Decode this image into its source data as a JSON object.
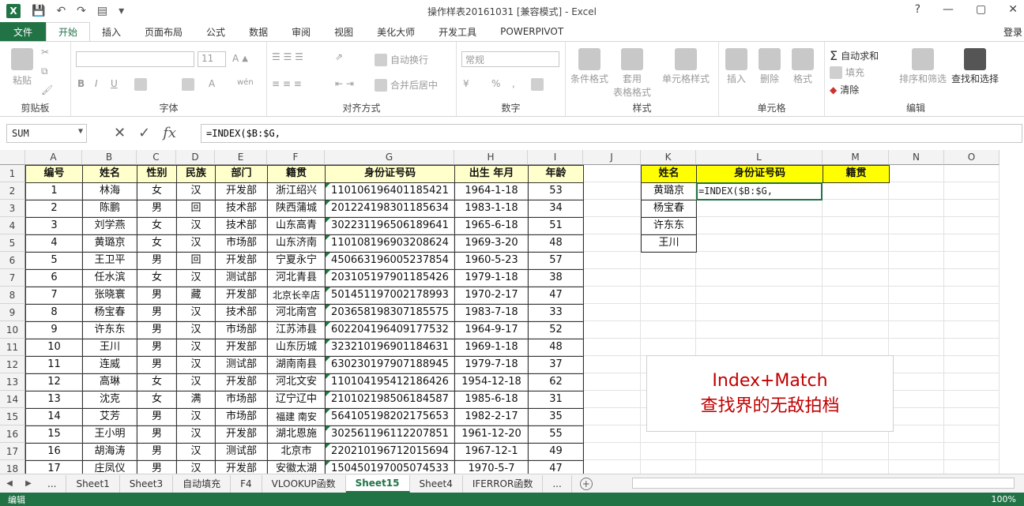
{
  "app": {
    "title": "操作样表20161031 [兼容模式] - Excel",
    "logo": "X"
  },
  "qat": {
    "save": "save-icon",
    "undo": "undo-icon",
    "redo": "redo-icon"
  },
  "window": {
    "help": "?",
    "minimize": "—",
    "restore": "▢",
    "close": "✕"
  },
  "tabs": [
    "开始",
    "插入",
    "页面布局",
    "公式",
    "数据",
    "审阅",
    "视图",
    "美化大师",
    "开发工具",
    "POWERPIVOT"
  ],
  "file_tab": "文件",
  "login": "登录",
  "ribbon": {
    "clipboard": {
      "paste": "粘贴",
      "label": "剪贴板"
    },
    "font": {
      "size": "11",
      "label": "字体",
      "bold": "B",
      "italic": "I",
      "underline": "U",
      "wen": "wén"
    },
    "alignment": {
      "wrap": "自动换行",
      "merge": "合并后居中",
      "label": "对齐方式"
    },
    "number": {
      "format": "常规",
      "pct": "%",
      "comma": ",",
      "label": "数字"
    },
    "styles": {
      "cond": "条件格式",
      "table1": "套用",
      "table2": "表格格式",
      "cell": "单元格样式",
      "label": "样式"
    },
    "cells": {
      "insert": "插入",
      "delete": "删除",
      "format": "格式",
      "label": "单元格"
    },
    "editing": {
      "autosum": "自动求和",
      "fill": "填充",
      "clear": "清除",
      "sort": "排序和筛选",
      "find": "查找和选择",
      "label": "编辑"
    }
  },
  "formula_bar": {
    "name_box": "SUM",
    "cancel": "✕",
    "enter": "✓",
    "fx": "fx",
    "formula": "=INDEX($B:$G,"
  },
  "columns": [
    "A",
    "B",
    "C",
    "D",
    "E",
    "F",
    "G",
    "H",
    "I",
    "J",
    "K",
    "L",
    "M",
    "N",
    "O"
  ],
  "rows": [
    "1",
    "2",
    "3",
    "4",
    "5",
    "6",
    "7",
    "8",
    "9",
    "10",
    "11",
    "12",
    "13",
    "14",
    "15",
    "16",
    "17",
    "18"
  ],
  "table": {
    "headers": [
      "编号",
      "姓名",
      "性别",
      "民族",
      "部门",
      "籍贯",
      "身份证号码",
      "出生 年月",
      "年龄"
    ],
    "data": [
      [
        "1",
        "林海",
        "女",
        "汉",
        "开发部",
        "浙江绍兴",
        "110106196401185421",
        "1964-1-18",
        "53"
      ],
      [
        "2",
        "陈鹏",
        "男",
        "回",
        "技术部",
        "陕西蒲城",
        "201224198301185634",
        "1983-1-18",
        "34"
      ],
      [
        "3",
        "刘学燕",
        "女",
        "汉",
        "技术部",
        "山东高青",
        "302231196506189641",
        "1965-6-18",
        "51"
      ],
      [
        "4",
        "黄璐京",
        "女",
        "汉",
        "市场部",
        "山东济南",
        "110108196903208624",
        "1969-3-20",
        "48"
      ],
      [
        "5",
        "王卫平",
        "男",
        "回",
        "开发部",
        "宁夏永宁",
        "450663196005237854",
        "1960-5-23",
        "57"
      ],
      [
        "6",
        "任水滨",
        "女",
        "汉",
        "测试部",
        "河北青县",
        "203105197901185426",
        "1979-1-18",
        "38"
      ],
      [
        "7",
        "张晓寰",
        "男",
        "藏",
        "开发部",
        "北京长辛店",
        "501451197002178993",
        "1970-2-17",
        "47"
      ],
      [
        "8",
        "杨宝春",
        "男",
        "汉",
        "技术部",
        "河北南宫",
        "203658198307185575",
        "1983-7-18",
        "33"
      ],
      [
        "9",
        "许东东",
        "男",
        "汉",
        "市场部",
        "江苏沛县",
        "602204196409177532",
        "1964-9-17",
        "52"
      ],
      [
        "10",
        "王川",
        "男",
        "汉",
        "开发部",
        "山东历城",
        "323210196901184631",
        "1969-1-18",
        "48"
      ],
      [
        "11",
        "连威",
        "男",
        "汉",
        "测试部",
        "湖南南县",
        "630230197907188945",
        "1979-7-18",
        "37"
      ],
      [
        "12",
        "高琳",
        "女",
        "汉",
        "开发部",
        "河北文安",
        "110104195412186426",
        "1954-12-18",
        "62"
      ],
      [
        "13",
        "沈克",
        "女",
        "满",
        "市场部",
        "辽宁辽中",
        "210102198506184587",
        "1985-6-18",
        "31"
      ],
      [
        "14",
        "艾芳",
        "男",
        "汉",
        "市场部",
        "福建  南安",
        "564105198202175653",
        "1982-2-17",
        "35"
      ],
      [
        "15",
        "王小明",
        "男",
        "汉",
        "开发部",
        "湖北恩施",
        "302561196112207851",
        "1961-12-20",
        "55"
      ],
      [
        "16",
        "胡海涛",
        "男",
        "汉",
        "测试部",
        "北京市",
        "220210196712015694",
        "1967-12-1",
        "49"
      ],
      [
        "17",
        "庄凤仪",
        "男",
        "汉",
        "开发部",
        "安徽太湖",
        "150450197005074533",
        "1970-5-7",
        "47"
      ]
    ]
  },
  "lookup": {
    "headers": [
      "姓名",
      "身份证号码",
      "籍贯"
    ],
    "names": [
      "黄璐京",
      "杨宝春",
      "许东东",
      "王川"
    ],
    "editing_formula": "=INDEX($B:$G,"
  },
  "callout": {
    "line1": "Index+Match",
    "line2": "查找界的无敌拍档"
  },
  "sheets": [
    "...",
    "Sheet1",
    "Sheet3",
    "自动填充",
    "F4",
    "VLOOKUP函数",
    "Sheet15",
    "Sheet4",
    "IFERROR函数",
    "..."
  ],
  "active_sheet": "Sheet15",
  "status": {
    "mode": "编辑",
    "zoom": "100%"
  },
  "colors": {
    "excel_green": "#217346",
    "header_fill": "#ffffcc",
    "lookup_header_fill": "#ffff00",
    "callout_text": "#c00000"
  }
}
